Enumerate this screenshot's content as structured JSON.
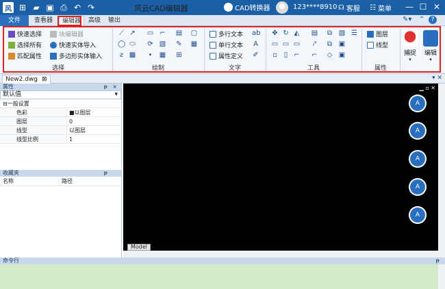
{
  "window": {
    "title": "风云CAD编辑器",
    "converter_label": "CAD转换器",
    "user": "123****8910",
    "service_label": "客服",
    "menu_label": "菜单",
    "minimize": "—",
    "maximize": "☐",
    "close": "✕"
  },
  "tabs": [
    {
      "label": "文件"
    },
    {
      "label": "查看器"
    },
    {
      "label": "编辑器"
    },
    {
      "label": "高级"
    },
    {
      "label": "输出"
    }
  ],
  "ribbon": {
    "select": {
      "label": "选择",
      "items": [
        "快速选择",
        "选择所有",
        "匹配属性",
        "块编辑器",
        "快速实体导入",
        "多边形实体输入"
      ]
    },
    "draw": {
      "label": "绘制"
    },
    "text": {
      "label": "文字",
      "items": [
        "多行文本",
        "单行文本",
        "属性定义"
      ]
    },
    "tools": {
      "label": "工具"
    },
    "properties": {
      "label": "属性",
      "items": [
        "图层",
        "线型"
      ]
    },
    "snap_label": "捕捉",
    "edit_label": "编辑"
  },
  "document": {
    "tab_name": "New2.dwg",
    "tab_close": "⊠",
    "model_tab": "Model"
  },
  "properties_panel": {
    "title": "属性",
    "pin": "ᵽ",
    "close": "×",
    "combo_value": "默认值",
    "section": "一般设置",
    "rows": [
      {
        "key": "色彩",
        "value": "■以图层"
      },
      {
        "key": "图层",
        "value": "0"
      },
      {
        "key": "线型",
        "value": "以图层"
      },
      {
        "key": "线型比例",
        "value": "1"
      }
    ]
  },
  "favorites_panel": {
    "title": "收藏夹",
    "col_name": "名称",
    "col_path": "路径"
  },
  "command_panel": {
    "title": "命令行"
  },
  "colors": {
    "titlebar": "#1b5fa6",
    "canvas": "#000000",
    "accent": "#2a6ec0",
    "highlight_box": "#e02020",
    "command_bg": "#d2ebc7"
  }
}
